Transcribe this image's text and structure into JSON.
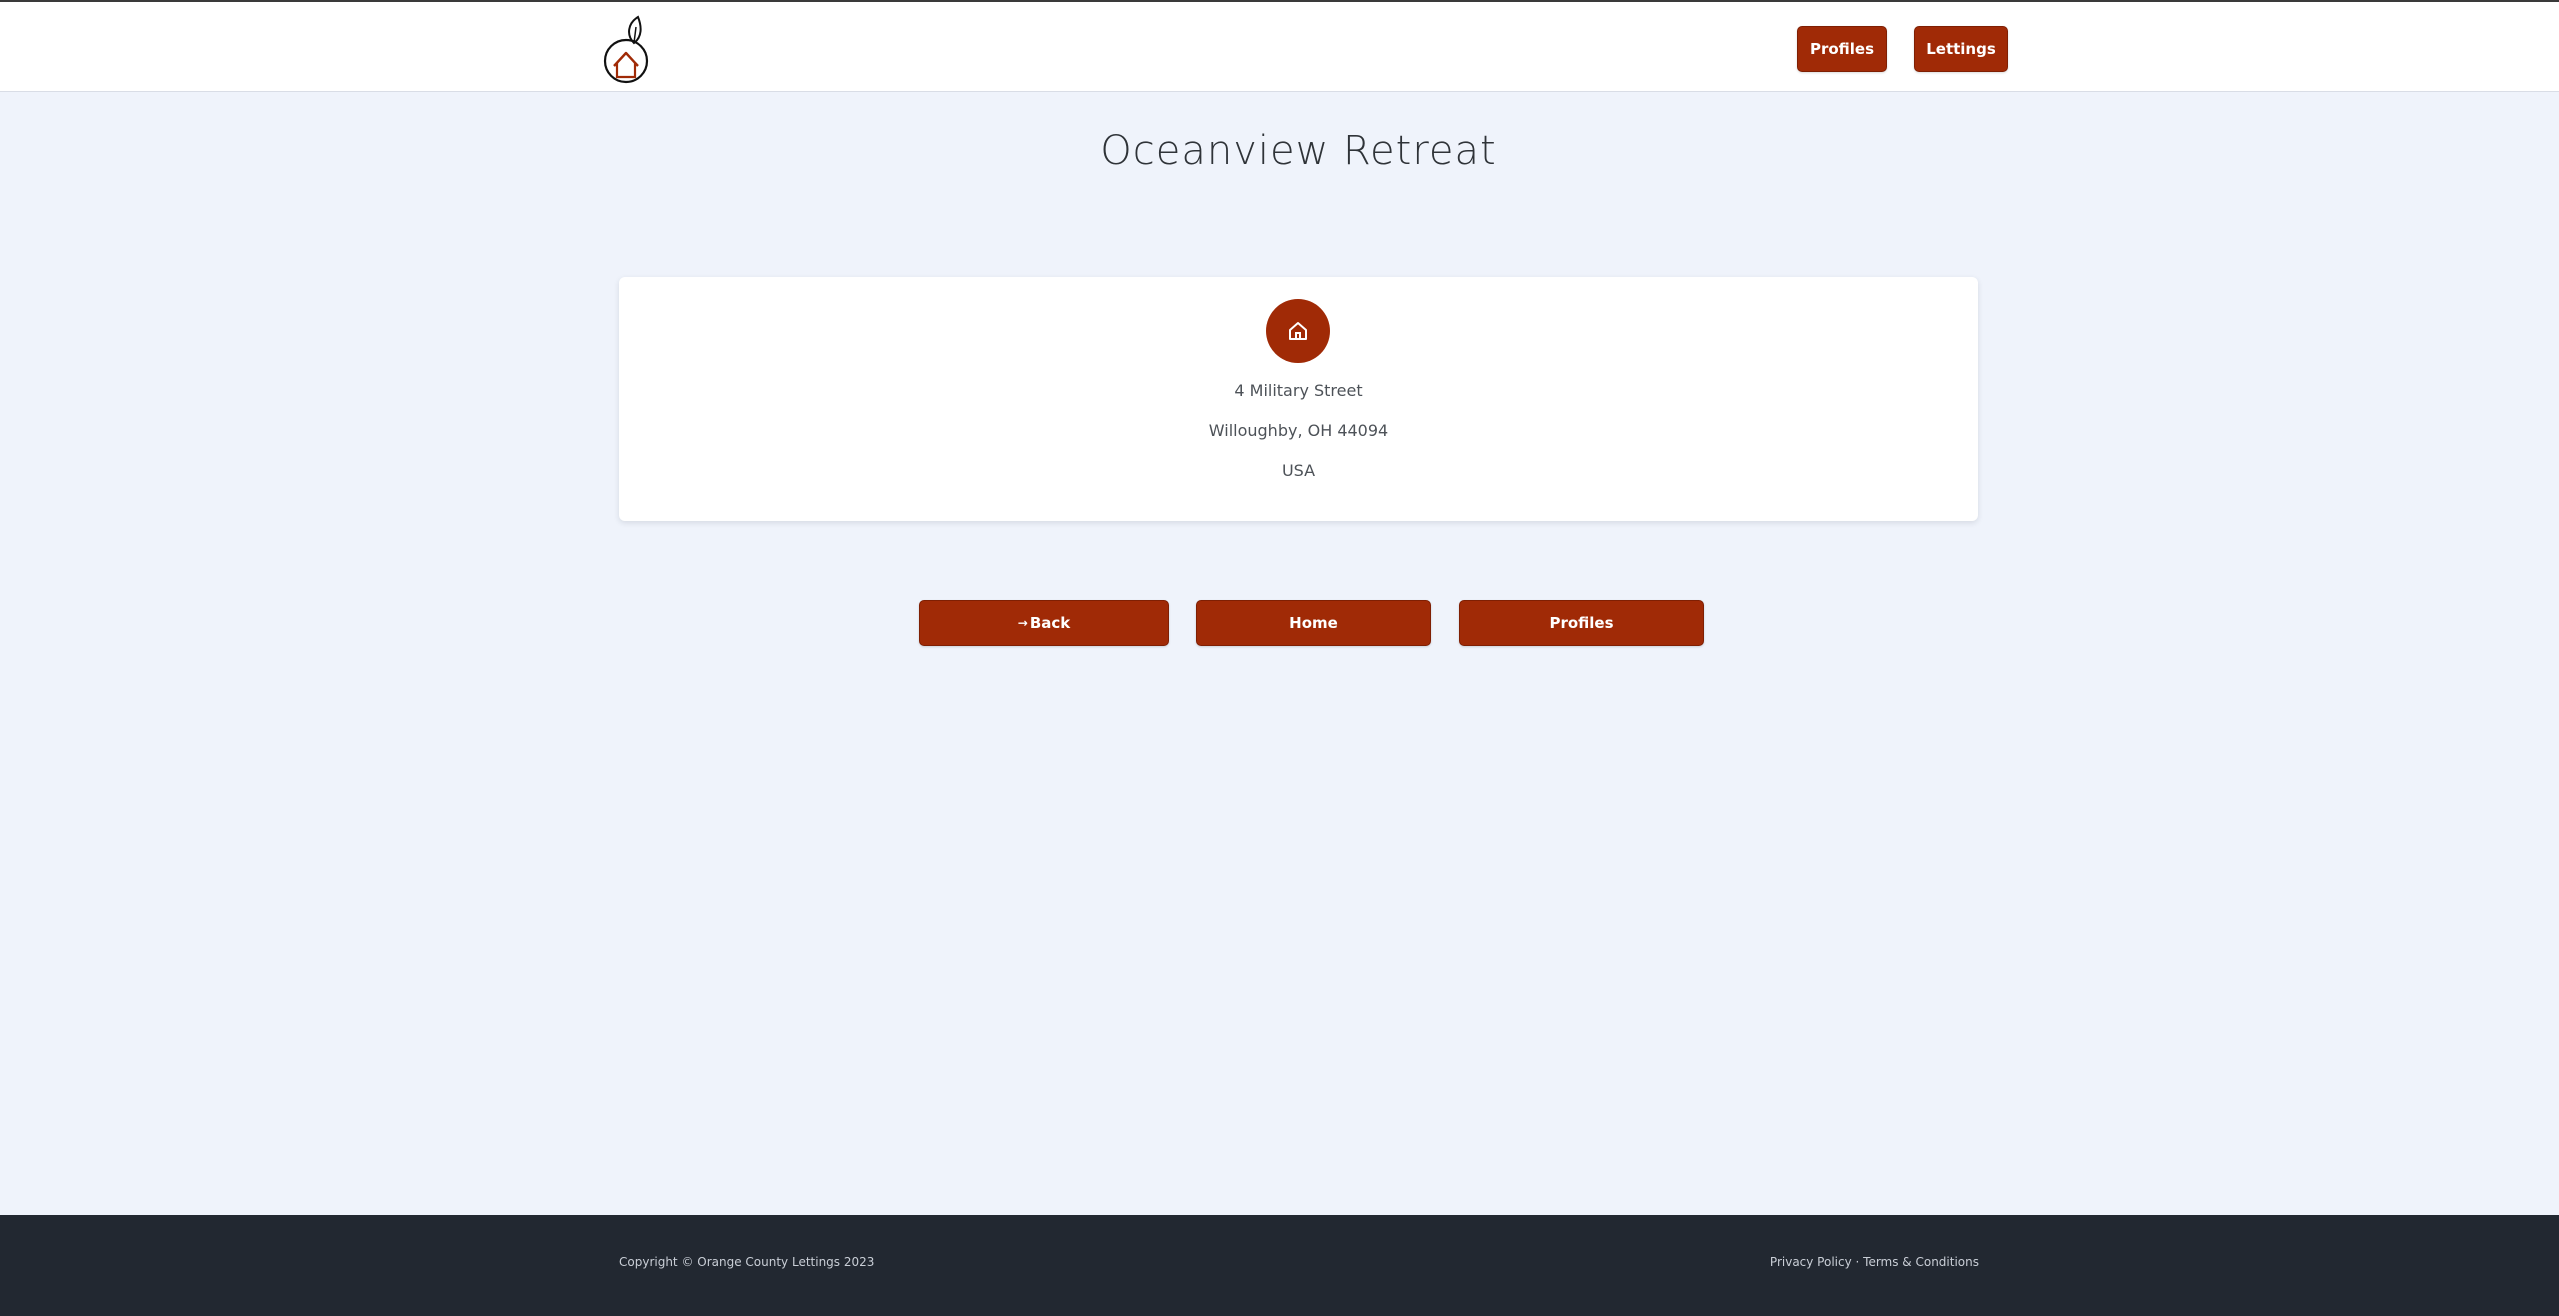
{
  "header": {
    "logo_name": "orange-house-logo",
    "nav": {
      "profiles_label": "Profiles",
      "lettings_label": "Lettings"
    }
  },
  "main": {
    "title": "Oceanview Retreat",
    "card": {
      "icon": "home-icon",
      "address_line1": "4 Military Street",
      "address_line2": "Willoughby, OH 44094",
      "address_line3": "USA"
    },
    "actions": {
      "back_arrow": "→",
      "back_label": "Back",
      "home_label": "Home",
      "profiles_label": "Profiles"
    }
  },
  "footer": {
    "copyright": "Copyright © Orange County Lettings 2023",
    "privacy_label": "Privacy Policy",
    "separator": " · ",
    "terms_label": "Terms & Conditions"
  },
  "colors": {
    "accent": "#a02a06",
    "page_bg": "#eff3fb",
    "footer_bg": "#222831"
  }
}
